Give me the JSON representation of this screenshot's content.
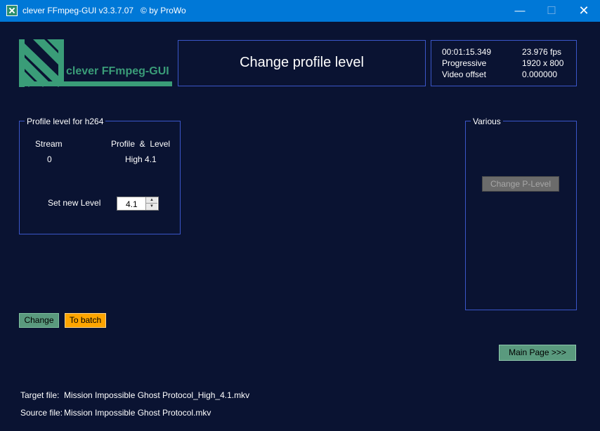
{
  "window": {
    "title": "clever FFmpeg-GUI v3.3.7.07   © by ProWo",
    "minimize_glyph": "—",
    "maximize_glyph": "☐",
    "close_glyph": "✕",
    "accent_color": "#0078d7"
  },
  "logo": {
    "text": "clever FFmpeg-GUI",
    "color": "#3a9c78"
  },
  "header": {
    "title": "Change profile level"
  },
  "info": {
    "time": "00:01:15.349",
    "fps": "23.976 fps",
    "scan": "Progressive",
    "resolution": "1920 x 800",
    "video_offset_label": "Video offset",
    "video_offset_value": "0.000000"
  },
  "profile_group": {
    "legend": "Profile level for h264",
    "stream_header": "Stream",
    "profile_header": "Profile  &  Level",
    "stream_value": "0",
    "profile_value": "High 4.1",
    "set_level_label": "Set new Level",
    "set_level_value": "4.1"
  },
  "various_group": {
    "legend": "Various",
    "change_p_level_label": "Change P-Level"
  },
  "buttons": {
    "change": "Change",
    "to_batch": "To batch",
    "main_page": "Main Page >>>"
  },
  "files": {
    "target_label": "Target file:",
    "target_value": "Mission Impossible Ghost Protocol_High_4.1.mkv",
    "source_label": "Source file:",
    "source_value": "Mission Impossible Ghost Protocol.mkv"
  },
  "colors": {
    "background": "#0a1332",
    "border": "#3b56c9",
    "button_green": "#5a9a7e",
    "button_orange": "#ffa500",
    "button_disabled": "#6b6b6b"
  }
}
